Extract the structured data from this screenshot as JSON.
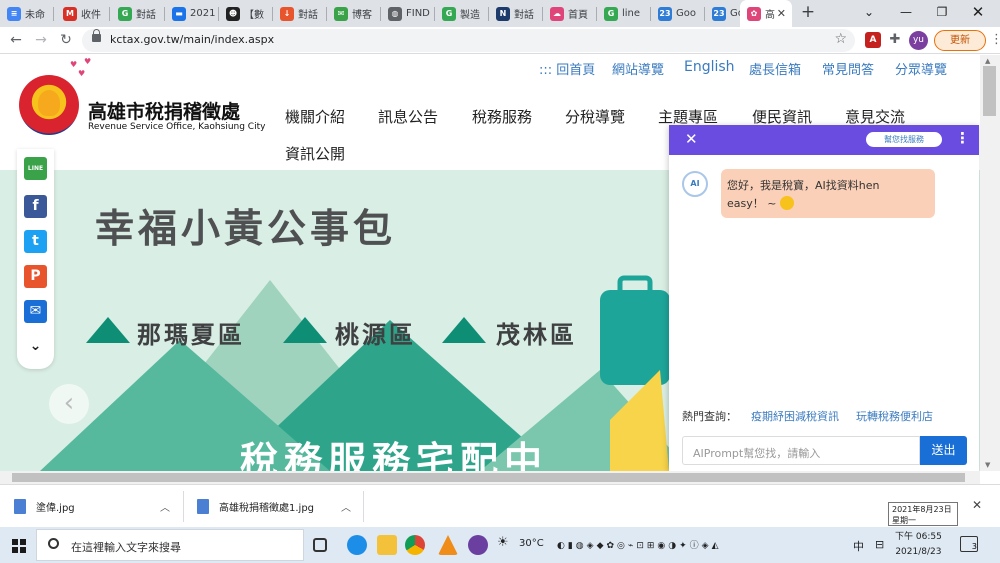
{
  "browser": {
    "tabs": [
      {
        "label": "未命",
        "color": "#4285f4",
        "glyph": "≡"
      },
      {
        "label": "收件",
        "color": "#d93025",
        "glyph": "M"
      },
      {
        "label": "對話",
        "color": "#34a853",
        "glyph": "G"
      },
      {
        "label": "2021",
        "color": "#1a73e8",
        "glyph": "▬"
      },
      {
        "label": "【數",
        "color": "#222222",
        "glyph": "☻"
      },
      {
        "label": "對話",
        "color": "#e8542b",
        "glyph": "↓"
      },
      {
        "label": "博客",
        "color": "#3aa34a",
        "glyph": "✉"
      },
      {
        "label": "FIND",
        "color": "#5f6368",
        "glyph": "◍"
      },
      {
        "label": "製造",
        "color": "#34a853",
        "glyph": "G"
      },
      {
        "label": "對話",
        "color": "#1c3b6b",
        "glyph": "N"
      },
      {
        "label": "首頁",
        "color": "#e0457a",
        "glyph": "☁"
      },
      {
        "label": "line",
        "color": "#34a853",
        "glyph": "G"
      },
      {
        "label": "Goo",
        "color": "#2e7cd6",
        "glyph": "23"
      },
      {
        "label": "Goo",
        "color": "#2e7cd6",
        "glyph": "23"
      },
      {
        "label": "高",
        "color": "#e0457a",
        "glyph": "✿",
        "active": true
      }
    ],
    "url": "kctax.gov.tw/main/index.aspx",
    "avatar_text": "yu",
    "update_label": "更新"
  },
  "site": {
    "name_cn": "高雄市稅捐稽徵處",
    "name_en": "Revenue Service Office, Kaohsiung City",
    "top_links": [
      "::: 回首頁",
      "網站導覽",
      "English",
      "處長信箱",
      "常見問答",
      "分眾導覽"
    ],
    "main_nav": [
      "機關介紹",
      "訊息公告",
      "稅務服務",
      "分稅導覽",
      "主題專區",
      "便民資訊",
      "意見交流",
      "資訊公開"
    ]
  },
  "banner": {
    "title": "幸福小黃公事包",
    "districts": [
      "那瑪夏區",
      "桃源區",
      "茂林區"
    ],
    "bottom_text": "稅務服務宅配中",
    "colors": {
      "background": "#d9eee4",
      "mountain": "#0d8e75"
    }
  },
  "social": [
    "LINE",
    "f",
    "t",
    "P",
    "✉",
    "⌄"
  ],
  "chat": {
    "help_label": "幫您找服務",
    "bot_label": "AI",
    "greeting_line1": "您好，我是稅寶，AI找資料hen",
    "greeting_line2": "easy！ ~",
    "hot_label": "熱門查詢：",
    "hot_links": [
      "疫期紓困減稅資訊",
      "玩轉稅務便利店"
    ],
    "input_placeholder": "AIPrompt幫您找，請輸入",
    "send_label": "送出",
    "header_color": "#6a4de0"
  },
  "downloads": {
    "files": [
      "塗偉.jpg",
      "高雄稅捐稽徵處1.jpg"
    ],
    "tooltip_line1": "2021年8月23日",
    "tooltip_line2": "星期一"
  },
  "taskbar": {
    "search_placeholder": "在這裡輸入文字來搜尋",
    "weather": "30°C",
    "ime": "中",
    "time_line1": "下午 06:55",
    "time_line2": "2021/8/23",
    "notification_count": "3"
  }
}
